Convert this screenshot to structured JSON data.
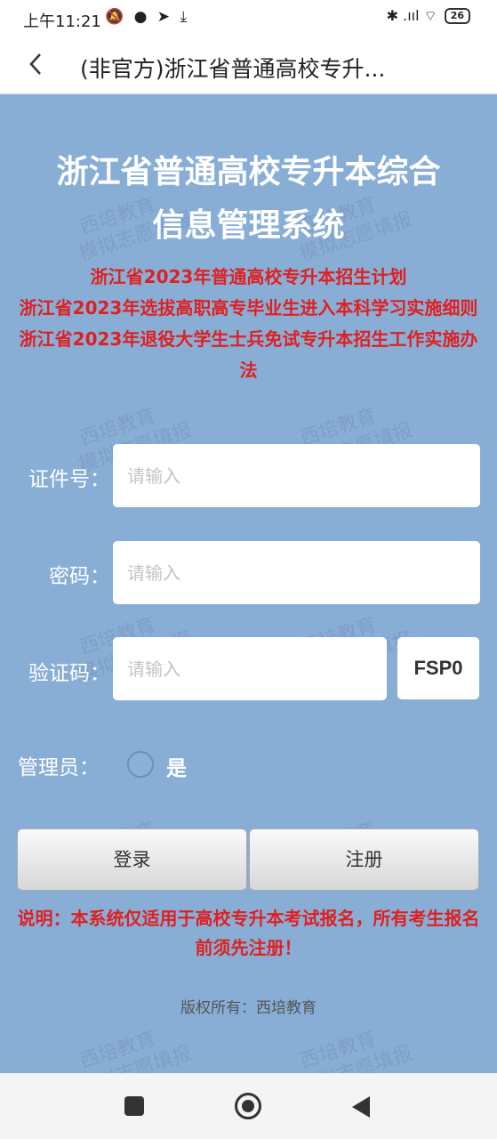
{
  "status_bar": {
    "time": "上午11:21",
    "left_icons": "🔕 ● ➤ ⤓",
    "right_icons": "✱ .ııl ⌔",
    "battery": "26"
  },
  "app_bar": {
    "back_icon": "chevron-left-icon",
    "title": "(非官方)浙江省普通高校专升..."
  },
  "watermark": [
    "西培教育",
    "模拟志愿填报"
  ],
  "page": {
    "title_line1": "浙江省普通高校专升本综合",
    "title_line2": "信息管理系统",
    "links": [
      "浙江省2023年普通高校专升本招生计划",
      "浙江省2023年选拔高职高专毕业生进入本科学习实施细则",
      "浙江省2023年退役大学生士兵免试专升本招生工作实施办法"
    ],
    "link_color": "#e02020",
    "background_color": "#88aed6"
  },
  "form": {
    "id_label": "证件号：",
    "id_placeholder": "请输入",
    "password_label": "密码：",
    "password_placeholder": "请输入",
    "captcha_label": "验证码：",
    "captcha_placeholder": "请输入",
    "captcha_code": "FSP0",
    "admin_label": "管理员：",
    "admin_option": "是",
    "admin_checked": false
  },
  "buttons": {
    "login": "登录",
    "register": "注册"
  },
  "note": "说明：本系统仅适用于高校专升本考试报名，所有考生报名前须先注册！",
  "copyright": "版权所有：西培教育",
  "nav_bar": {
    "recents_icon": "square-icon",
    "home_icon": "home-circle-icon",
    "back_icon": "triangle-back-icon"
  }
}
